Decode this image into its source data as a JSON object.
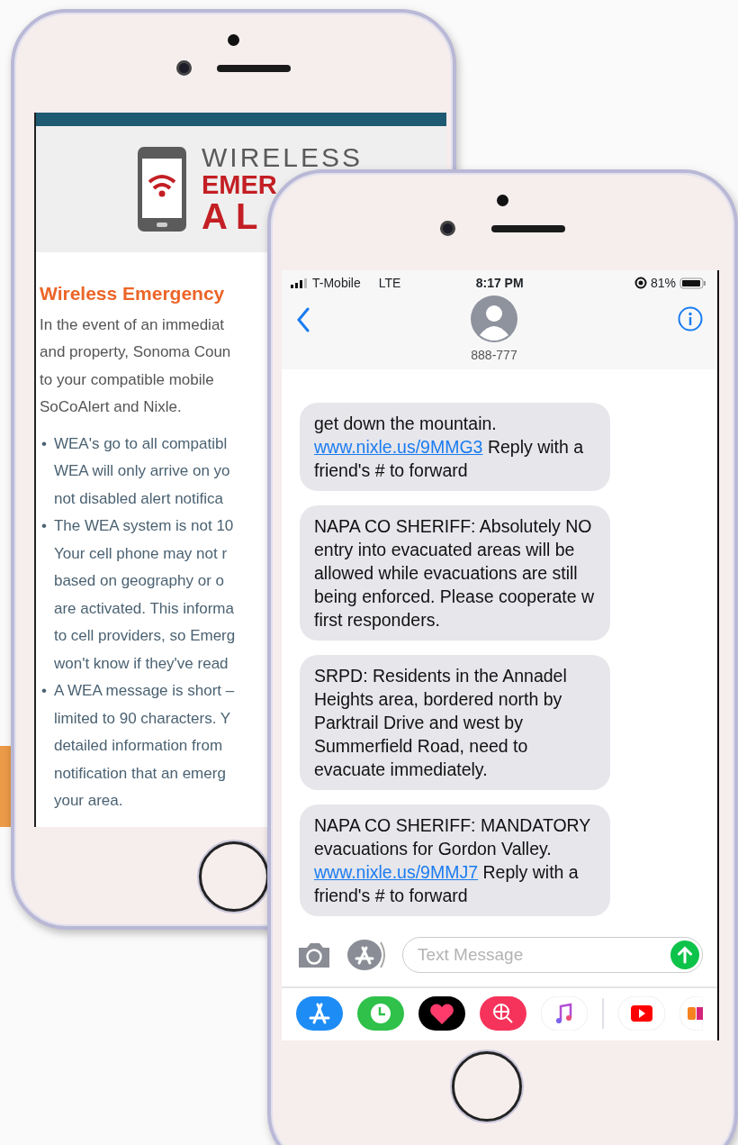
{
  "left_phone": {
    "logo": {
      "top": "WIRELESS",
      "middle": "EMER",
      "bottom": "AL"
    },
    "heading": "Wireless Emergency",
    "intro_lines": [
      "In the event of an immediat",
      "and property, Sonoma Coun",
      "to your compatible mobile",
      "SoCoAlert and Nixle."
    ],
    "bullets": [
      {
        "marker": "•",
        "lines": [
          "WEA's go to all compatibl",
          "WEA will only arrive on yo",
          "not disabled alert notifica"
        ]
      },
      {
        "marker": "•",
        "lines": [
          "The WEA system is not 10",
          "Your cell phone may not r",
          "based on geography or o",
          "are activated. This informa",
          "to cell providers, so Emerg",
          "won't know if they've read"
        ]
      },
      {
        "marker": "•",
        "lines": [
          "A WEA message is short –",
          "limited to 90 characters. Y",
          "detailed information from",
          "notification that an emerg",
          "your area."
        ]
      }
    ]
  },
  "right_phone": {
    "status_bar": {
      "carrier": "T-Mobile",
      "network": "LTE",
      "time": "8:17 PM",
      "battery": "81%"
    },
    "contact": {
      "name": "888-777"
    },
    "messages": [
      {
        "parts": [
          {
            "kind": "text",
            "text": "get down the mountain. "
          },
          {
            "kind": "link",
            "text": "www.nixle.us/9MMG3"
          },
          {
            "kind": "text",
            "text": " Reply with a friend's # to forward"
          }
        ]
      },
      {
        "parts": [
          {
            "kind": "text",
            "text": "NAPA CO SHERIFF: Absolutely NO entry into evacuated areas will be allowed while evacuations are still being enforced. Please cooperate w first responders."
          }
        ]
      },
      {
        "parts": [
          {
            "kind": "text",
            "text": "SRPD: Residents in the Annadel Heights area, bordered north by Parktrail Drive and west by Summerfield Road, need to evacuate immediately."
          }
        ]
      },
      {
        "parts": [
          {
            "kind": "text",
            "text": "NAPA CO SHERIFF: MANDATORY evacuations for Gordon Valley. "
          },
          {
            "kind": "link",
            "text": "www.nixle.us/9MMJ7"
          },
          {
            "kind": "text",
            "text": " Reply with a friend's # to forward"
          }
        ]
      }
    ],
    "composer": {
      "placeholder": "Text Message"
    }
  }
}
